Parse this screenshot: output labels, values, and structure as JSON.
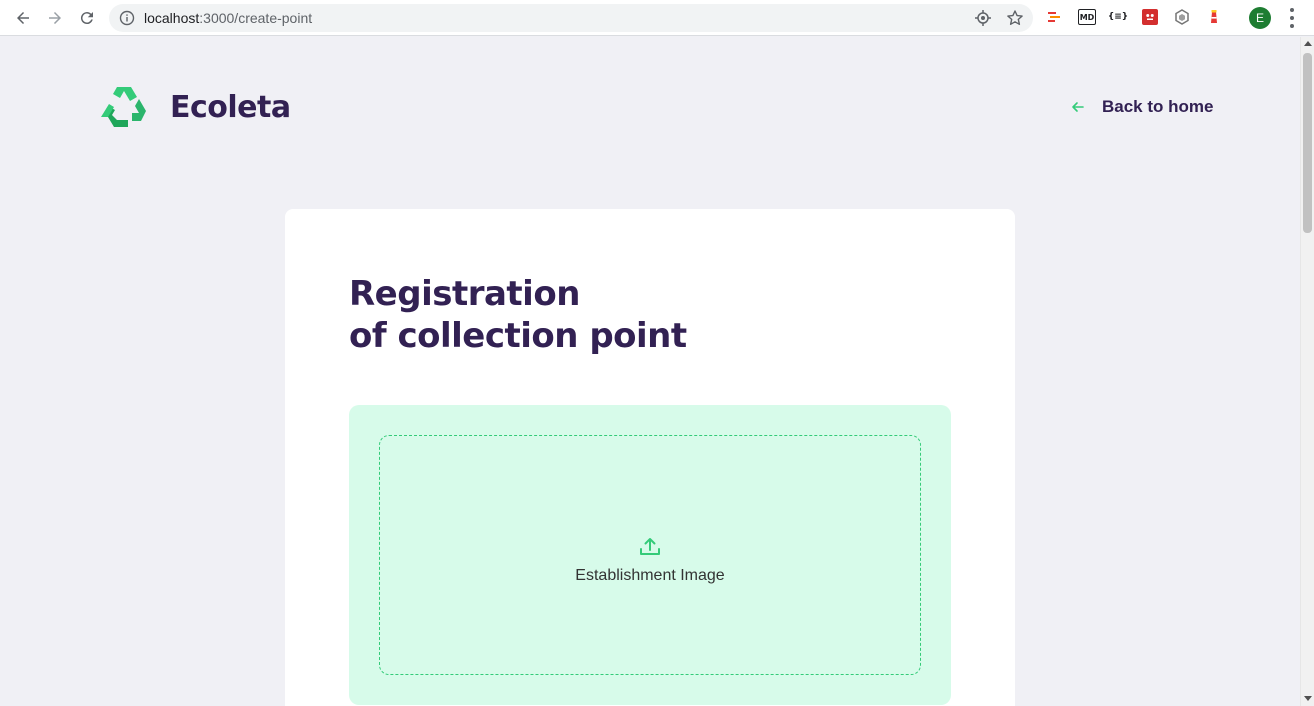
{
  "browser": {
    "url_host": "localhost",
    "url_path": ":3000/create-point",
    "extensions": [
      "MD",
      "{≡}"
    ],
    "profile_initial": "E"
  },
  "header": {
    "brand": "Ecoleta",
    "back_link": "Back to home"
  },
  "form": {
    "title_line1": "Registration",
    "title_line2": "of collection point",
    "dropzone_label": "Establishment Image"
  },
  "colors": {
    "primary": "#34cb79",
    "title": "#322153",
    "background": "#f0f0f5",
    "dropzone_bg": "#d7fbea"
  }
}
